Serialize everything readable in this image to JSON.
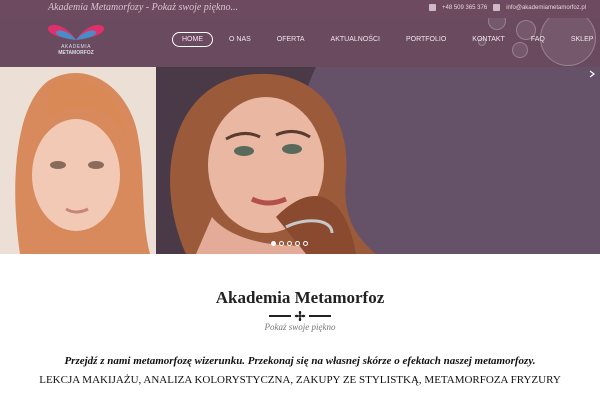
{
  "topbar": {
    "tagline": "Akademia Metamorfozy - Pokaż swoje piękno...",
    "phone": "+48 509 365 376",
    "email": "info@akademiametamorfoz.pl"
  },
  "logo": {
    "line1": "AKADEMIA",
    "line2": "METAMORFOZ"
  },
  "nav": {
    "items": [
      {
        "label": "HOME",
        "active": true
      },
      {
        "label": "O NAS"
      },
      {
        "label": "OFERTA"
      },
      {
        "label": "AKTUALNOŚCI"
      },
      {
        "label": "PORTFOLIO"
      },
      {
        "label": "KONTAKT"
      },
      {
        "label": "FAQ"
      },
      {
        "label": "SKLEP"
      }
    ]
  },
  "slider": {
    "slide_count": 5,
    "active_index": 0
  },
  "content": {
    "title": "Akademia Metamorfoz",
    "subtitle": "Pokaż swoje piękno",
    "lead": "Przejdź z nami metamorfozę wizerunku. Przekonaj się na własnej skórze o efektach naszej metamorfozy.",
    "services": "LEKCJA MAKIJAŻU, ANALIZA KOLORYSTYCZNA, ZAKUPY ZE STYLISTKĄ, METAMORFOZA FRYZURY"
  },
  "colors": {
    "header_bg": "#6a4a5f",
    "topbar_bg": "#6d4a5f",
    "accent_pink": "#e0306a"
  },
  "icons": [
    "phone-icon",
    "email-icon",
    "logo-butterfly-icon",
    "flower-ornament-icon"
  ]
}
